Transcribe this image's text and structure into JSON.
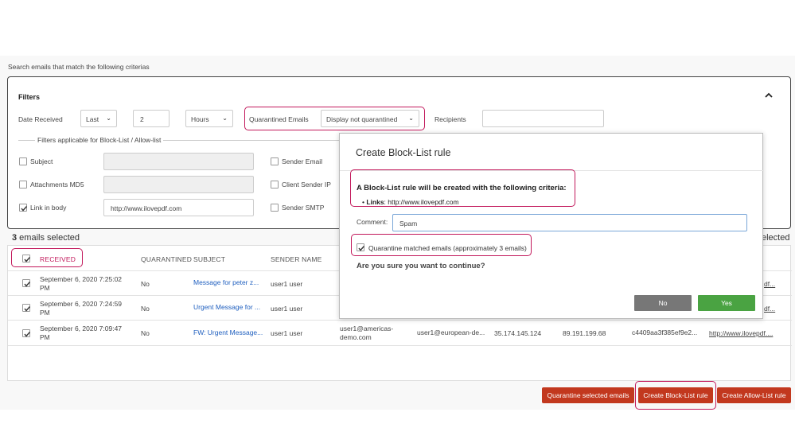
{
  "hint": "Search emails that match the following criterias",
  "filters": {
    "title": "Filters",
    "date_received_label": "Date Received",
    "period_select": "Last",
    "period_value": "2",
    "unit_select": "Hours",
    "quarantined_label": "Quarantined Emails",
    "quarantined_select": "Display not quarantined",
    "recipients_label": "Recipients",
    "recipients_value": "",
    "section_label": "Filters applicable for Block-List / Allow-list",
    "subject_label": "Subject",
    "attachments_label": "Attachments MD5",
    "link_label": "Link in body",
    "link_value": "http://www.ilovepdf.com",
    "sender_email_label": "Sender Email",
    "client_sender_ip_label": "Client Sender IP",
    "sender_smtp_label": "Sender SMTP"
  },
  "selection": {
    "count": "3",
    "label": " emails selected",
    "right_fragment": "elected"
  },
  "table": {
    "headers": {
      "received": "RECEIVED",
      "quarantined": "QUARANTINED",
      "subject": "SUBJECT",
      "sender_name": "SENDER NAME"
    },
    "rows": [
      {
        "received_1": "September 6, 2020 7:25:02",
        "received_2": "PM",
        "quarantined": "No",
        "subject": "Message for peter z...",
        "sender_name": "user1 user",
        "link": "df..."
      },
      {
        "received_1": "September 6, 2020 7:24:59",
        "received_2": "PM",
        "quarantined": "No",
        "subject": "Urgent Message for ...",
        "sender_name": "user1 user",
        "link": "df..."
      },
      {
        "received_1": "September 6, 2020 7:09:47",
        "received_2": "PM",
        "quarantined": "No",
        "subject": "FW: Urgent Message...",
        "sender_name": "user1 user",
        "sender_email_1": "user1@americas-",
        "sender_email_2": "demo.com",
        "recipient": "user1@european-de...",
        "client_ip": "35.174.145.124",
        "smtp_ip": "89.191.199.68",
        "md5": "c4409aa3f385ef9e2...",
        "link": "http://www.ilovepdf...."
      }
    ]
  },
  "buttons": {
    "quarantine": "Quarantine selected emails",
    "block_list": "Create Block-List rule",
    "allow_list": "Create Allow-List rule"
  },
  "modal": {
    "title": "Create Block-List rule",
    "intro": "A Block-List rule will be created with the following criteria:",
    "links_key": "Links",
    "links_value": ": http://www.ilovepdf.com",
    "comment_label": "Comment:",
    "comment_value": "Spam",
    "quarantine_label": "Quarantine matched emails (approximately 3 emails)",
    "confirm": "Are you sure you want to continue?",
    "no": "No",
    "yes": "Yes"
  },
  "colors": {
    "highlight": "#c2185b",
    "action_red": "#c2381e",
    "yes_green": "#4aa342",
    "link_blue": "#1f5fbf"
  }
}
